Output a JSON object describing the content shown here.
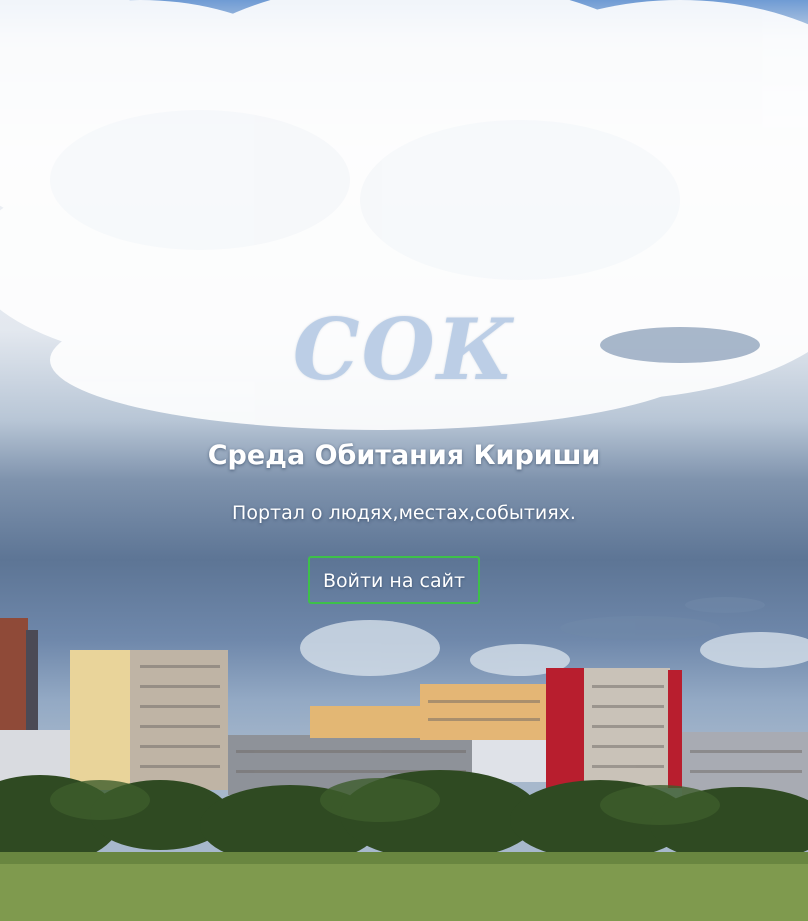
{
  "hero": {
    "logo_text": "СОК",
    "title": "Среда Обитания Кириши",
    "subtitle": "Портал о людях,местах,событиях.",
    "login_button_label": "Войти на сайт"
  },
  "colors": {
    "button_border": "#3ec04a",
    "logo": "#b8cce5",
    "text": "#ffffff"
  },
  "background": {
    "icon": "cityscape-photo"
  }
}
